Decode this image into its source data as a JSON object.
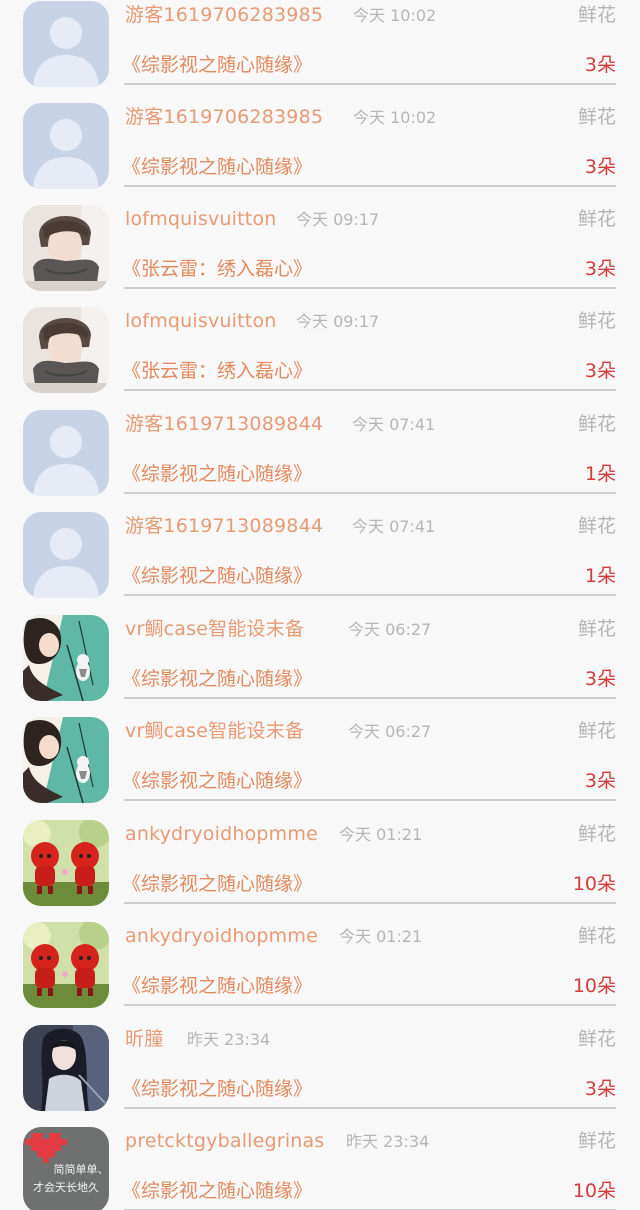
{
  "gift_list": [
    {
      "user": "游客1619706283985",
      "time": "今天 10:02",
      "gift_type": "鲜花",
      "book": "《综影视之随心随缘》",
      "amount": "3朵",
      "avatar_icon": "default-avatar-icon"
    },
    {
      "user": "游客1619706283985",
      "time": "今天 10:02",
      "gift_type": "鲜花",
      "book": "《综影视之随心随缘》",
      "amount": "3朵",
      "avatar_icon": "default-avatar-icon"
    },
    {
      "user": "lofmquisvuitton",
      "time": "今天 09:17",
      "gift_type": "鲜花",
      "book": "《张云雷：绣入磊心》",
      "amount": "3朵",
      "avatar_icon": "boy-scarf-avatar-icon"
    },
    {
      "user": "lofmquisvuitton",
      "time": "今天 09:17",
      "gift_type": "鲜花",
      "book": "《张云雷：绣入磊心》",
      "amount": "3朵",
      "avatar_icon": "boy-scarf-avatar-icon"
    },
    {
      "user": "游客1619713089844",
      "time": "今天 07:41",
      "gift_type": "鲜花",
      "book": "《综影视之随心随缘》",
      "amount": "1朵",
      "avatar_icon": "default-avatar-icon"
    },
    {
      "user": "游客1619713089844",
      "time": "今天 07:41",
      "gift_type": "鲜花",
      "book": "《综影视之随心随缘》",
      "amount": "1朵",
      "avatar_icon": "default-avatar-icon"
    },
    {
      "user": "vr鲷case智能设末备",
      "time": "今天 06:27",
      "gift_type": "鲜花",
      "book": "《综影视之随心随缘》",
      "amount": "3朵",
      "avatar_icon": "girl-cat-avatar-icon"
    },
    {
      "user": "vr鲷case智能设末备",
      "time": "今天 06:27",
      "gift_type": "鲜花",
      "book": "《综影视之随心随缘》",
      "amount": "3朵",
      "avatar_icon": "girl-cat-avatar-icon"
    },
    {
      "user": "ankydryoidhopmme",
      "time": "今天 01:21",
      "gift_type": "鲜花",
      "book": "《综影视之随心随缘》",
      "amount": "10朵",
      "avatar_icon": "red-dolls-avatar-icon"
    },
    {
      "user": "ankydryoidhopmme",
      "time": "今天 01:21",
      "gift_type": "鲜花",
      "book": "《综影视之随心随缘》",
      "amount": "10朵",
      "avatar_icon": "red-dolls-avatar-icon"
    },
    {
      "user": "昕朣",
      "time": "昨天 23:34",
      "gift_type": "鲜花",
      "book": "《综影视之随心随缘》",
      "amount": "3朵",
      "avatar_icon": "anime-girl-avatar-icon"
    },
    {
      "user": "pretcktgyballegrinas",
      "time": "昨天 23:34",
      "gift_type": "鲜花",
      "book": "《综影视之随心随缘》",
      "amount": "10朵",
      "avatar_icon": "pixel-heart-avatar-icon",
      "avatar_text": [
        "简简单单、",
        "才会天长地久"
      ]
    }
  ]
}
